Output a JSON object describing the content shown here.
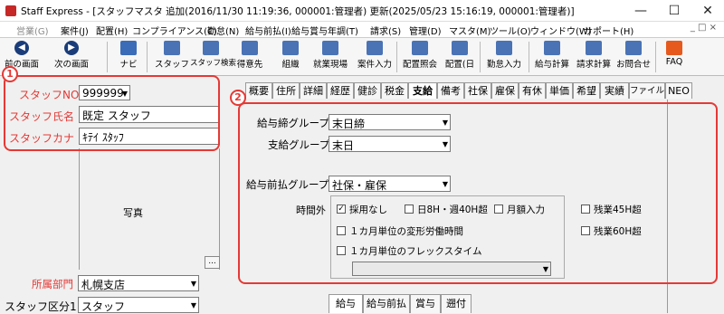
{
  "window": {
    "title": "Staff Express - [スタッフマスタ 追加(2016/11/30 11:19:36, 000001:管理者) 更新(2025/05/23 15:16:19, 000001:管理者)]",
    "minimize": "—",
    "maximize": "☐",
    "close": "✕"
  },
  "menu": {
    "items": [
      "営業(G)",
      "案件(J)",
      "配置(H)",
      "コンプライアンス(C)",
      "勤怠(N)",
      "給与前払(I)",
      "給与賞与年調(T)",
      "請求(S)",
      "管理(D)",
      "マスタ(M)",
      "ツール(O)",
      "ウィンドウ(W)",
      "サポート(H)"
    ],
    "right": "_ □ ×"
  },
  "toolbar": {
    "prev": "前の画面",
    "next": "次の画面",
    "navi": "ナビ",
    "staff": "スタッフ",
    "staff_search": "スタッフ検索",
    "client": "得意先",
    "org": "組織",
    "site": "就業現場",
    "case_input": "案件入力",
    "assign_view": "配置照会",
    "assign_day": "配置(日",
    "attendance": "勤怠入力",
    "pay_calc": "給与計算",
    "bill_calc": "請求計算",
    "contact": "お問合せ",
    "faq": "FAQ"
  },
  "left": {
    "staff_no_label": "スタッフNO",
    "staff_no": "999999",
    "staff_name_label": "スタッフ氏名",
    "staff_name": "既定 スタッフ",
    "staff_kana_label": "スタッフカナ",
    "staff_kana": "ｷﾃｲ ｽﾀｯﾌ",
    "photo": "写真",
    "photo_btn": "...",
    "dept_label": "所属部門",
    "dept": "札幌支店",
    "kubun_label": "スタッフ区分1",
    "kubun": "スタッフ"
  },
  "tabs": [
    "概要",
    "住所",
    "詳細",
    "経歴",
    "健診",
    "税金",
    "支給",
    "備考",
    "社保",
    "雇保",
    "有休",
    "単価",
    "希望",
    "実績",
    "ファイル",
    "NEO"
  ],
  "form": {
    "pay_close_label": "給与締グループ",
    "pay_close": "末日締",
    "pay_group_label": "支給グループ",
    "pay_group": "末日",
    "prepay_label": "給与前払グループ",
    "prepay": "社保・雇保",
    "overtime_label": "時間外",
    "cb_none": "採用なし",
    "cb_8h": "日8H・週40H超",
    "cb_monthly": "月額入力",
    "cb_45": "残業45H超",
    "cb_60": "残業60H超",
    "cb_var": "１カ月単位の変形労働時間",
    "cb_flex": "１カ月単位のフレックスタイム",
    "flex_select": ""
  },
  "bottom_tabs": [
    "給与",
    "給与前払",
    "賞与",
    "遡付"
  ],
  "badges": {
    "one": "1",
    "two": "2"
  }
}
